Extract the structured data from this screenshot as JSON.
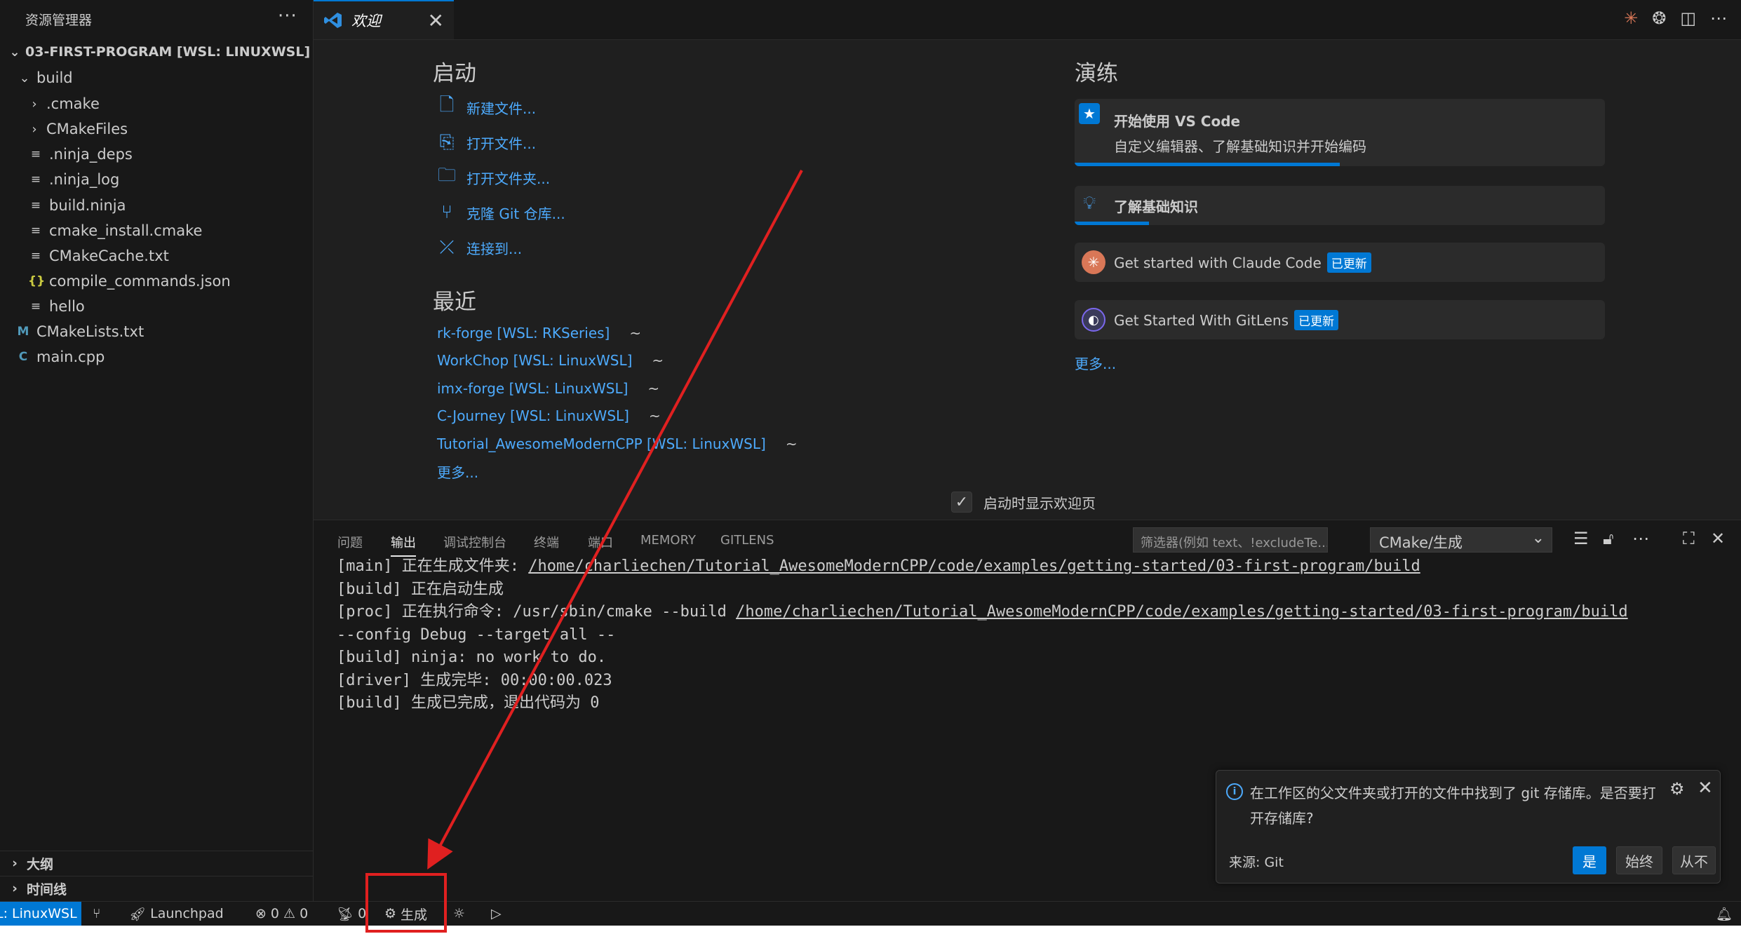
{
  "sidebar": {
    "header": "资源管理器",
    "more_icon": "···",
    "root": "03-FIRST-PROGRAM [WSL: LINUXWSL]",
    "items": [
      {
        "label": "build",
        "type": "folder-open"
      },
      {
        "label": ".cmake",
        "type": "folder"
      },
      {
        "label": "CMakeFiles",
        "type": "folder"
      },
      {
        "label": ".ninja_deps",
        "type": "file"
      },
      {
        "label": ".ninja_log",
        "type": "file"
      },
      {
        "label": "build.ninja",
        "type": "file"
      },
      {
        "label": "cmake_install.cmake",
        "type": "file"
      },
      {
        "label": "CMakeCache.txt",
        "type": "file"
      },
      {
        "label": "compile_commands.json",
        "type": "json"
      },
      {
        "label": "hello",
        "type": "file"
      },
      {
        "label": "CMakeLists.txt",
        "type": "cmake"
      },
      {
        "label": "main.cpp",
        "type": "cpp"
      }
    ],
    "outline": "大纲",
    "timeline": "时间线"
  },
  "tab": {
    "label": "欢迎",
    "close": "✕"
  },
  "welcome": {
    "start_heading": "启动",
    "start_items": [
      {
        "label": "新建文件...",
        "icon": "new-file-icon"
      },
      {
        "label": "打开文件...",
        "icon": "open-file-icon"
      },
      {
        "label": "打开文件夹...",
        "icon": "open-folder-icon"
      },
      {
        "label": "克隆 Git 仓库...",
        "icon": "git-clone-icon"
      },
      {
        "label": "连接到...",
        "icon": "remote-connect-icon"
      }
    ],
    "recent_heading": "最近",
    "recent": [
      {
        "name": "rk-forge [WSL: RKSeries]",
        "path": "~"
      },
      {
        "name": "WorkChop [WSL: LinuxWSL]",
        "path": "~"
      },
      {
        "name": "imx-forge [WSL: LinuxWSL]",
        "path": "~"
      },
      {
        "name": "C-Journey [WSL: LinuxWSL]",
        "path": "~"
      },
      {
        "name": "Tutorial_AwesomeModernCPP [WSL: LinuxWSL]",
        "path": "~"
      }
    ],
    "recent_more": "更多...",
    "walk_heading": "演练",
    "walk_get_started_title": "开始使用 VS Code",
    "walk_get_started_desc": "自定义编辑器、了解基础知识并开始编码",
    "walk_get_started_progress": 0.5,
    "walk_fundamentals_title": "了解基础知识",
    "walk_fundamentals_progress": 0.14,
    "walk_claude_title": "Get started with Claude Code",
    "walk_gitlens_title": "Get Started With GitLens",
    "badge_updated": "已更新",
    "walk_more": "更多...",
    "show_on_startup": "启动时显示欢迎页"
  },
  "panel": {
    "tabs": [
      "问题",
      "输出",
      "调试控制台",
      "终端",
      "端口",
      "MEMORY",
      "GITLENS"
    ],
    "active_tab": "输出",
    "filter_placeholder": "筛选器(例如 text、!excludeTe...",
    "channel": "CMake/生成",
    "output_lines": [
      {
        "prefix": "[main] 正在生成文件夹: ",
        "link": "/home/charliechen/Tutorial_AwesomeModernCPP/code/examples/getting-started/03-first-program/build"
      },
      {
        "prefix": "[build] 正在启动生成",
        "link": ""
      },
      {
        "prefix": "[proc] 正在执行命令: /usr/sbin/cmake --build ",
        "link": "/home/charliechen/Tutorial_AwesomeModernCPP/code/examples/getting-started/03-first-program/build"
      },
      {
        "prefix": "--config Debug --target all --",
        "link": ""
      },
      {
        "prefix": "[build] ninja: no work to do.",
        "link": ""
      },
      {
        "prefix": "[driver] 生成完毕: 00:00:00.023",
        "link": ""
      },
      {
        "prefix": "[build] 生成已完成，退出代码为 0",
        "link": ""
      }
    ]
  },
  "notification": {
    "message": "在工作区的父文件夹或打开的文件中找到了 git 存储库。是否要打开存储库?",
    "source": "来源: Git",
    "btn_yes": "是",
    "btn_always": "始终",
    "btn_never": "从不"
  },
  "statusbar": {
    "remote": "L: LinuxWSL",
    "launchpad": "Launchpad",
    "errors": "0",
    "warnings": "0",
    "ports": "0",
    "build": "生成"
  },
  "colors": {
    "accent": "#0078d4",
    "link": "#4daafc",
    "annotation": "#e02020"
  }
}
